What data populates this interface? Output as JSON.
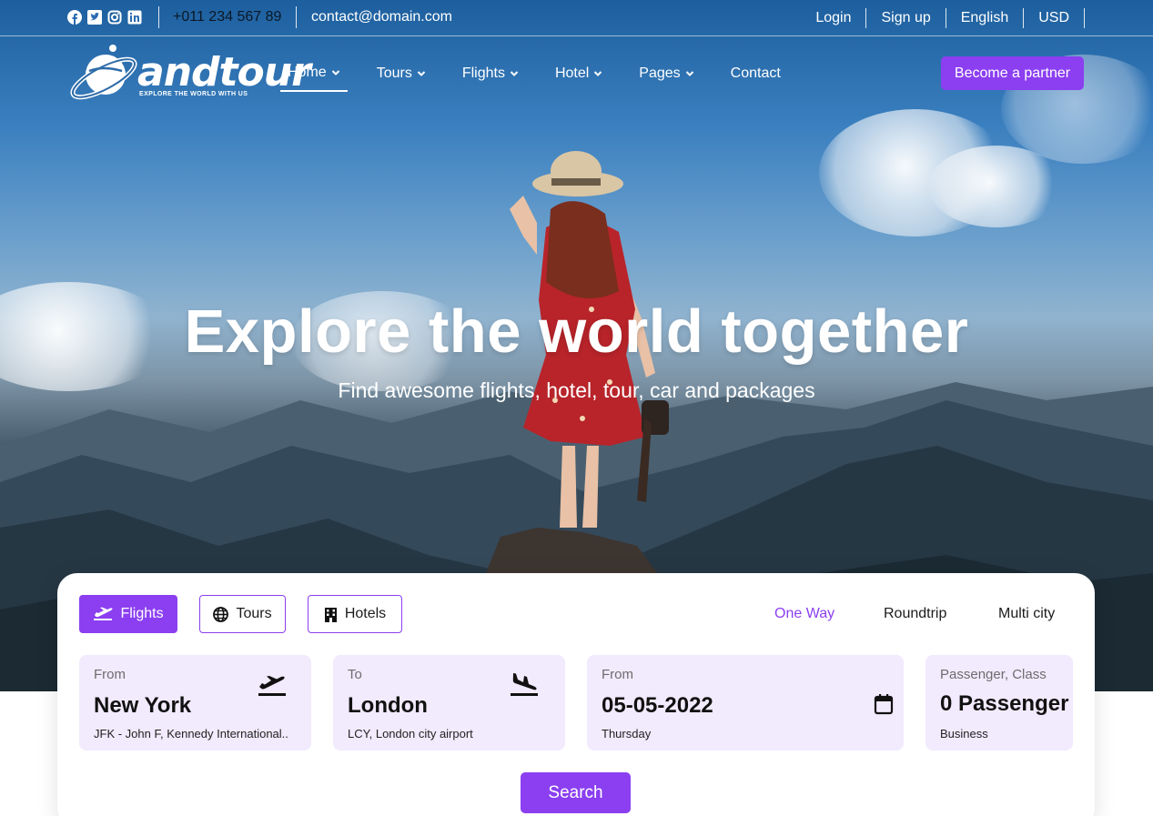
{
  "topbar": {
    "phone": "+011 234 567 89",
    "email": "contact@domain.com",
    "social_icons": [
      "facebook-icon",
      "twitter-icon",
      "instagram-icon",
      "linkedin-icon"
    ],
    "right_links": [
      "Login",
      "Sign up",
      "English",
      "USD"
    ]
  },
  "brand": {
    "name": "andtour",
    "tagline": "EXPLORE THE WORLD WITH US"
  },
  "nav": {
    "items": [
      {
        "label": "Home",
        "dropdown": true,
        "active": true
      },
      {
        "label": "Tours",
        "dropdown": true
      },
      {
        "label": "Flights",
        "dropdown": true
      },
      {
        "label": "Hotel",
        "dropdown": true
      },
      {
        "label": "Pages",
        "dropdown": true
      },
      {
        "label": "Contact",
        "dropdown": false
      }
    ],
    "cta": "Become a partner"
  },
  "hero": {
    "title": "Explore the world together",
    "subtitle": "Find awesome flights, hotel, tour, car and packages"
  },
  "search": {
    "tabs": [
      {
        "label": "Flights",
        "icon": "plane-icon",
        "active": true
      },
      {
        "label": "Tours",
        "icon": "globe-icon"
      },
      {
        "label": "Hotels",
        "icon": "hotel-icon"
      }
    ],
    "trip_types": [
      {
        "label": "One Way",
        "active": true
      },
      {
        "label": "Roundtrip"
      },
      {
        "label": "Multi city"
      }
    ],
    "from": {
      "label": "From",
      "value": "New York",
      "sub": "JFK - John F, Kennedy International.."
    },
    "to": {
      "label": "To",
      "value": "London",
      "sub": "LCY, London city airport"
    },
    "date": {
      "label": "From",
      "value": "05-05-2022",
      "sub": "Thursday"
    },
    "passenger": {
      "label": "Passenger, Class",
      "value": "0 Passenger",
      "sub": "Business"
    },
    "button": "Search"
  },
  "colors": {
    "accent": "#8b3ff0",
    "field_bg": "#f2eafd"
  }
}
